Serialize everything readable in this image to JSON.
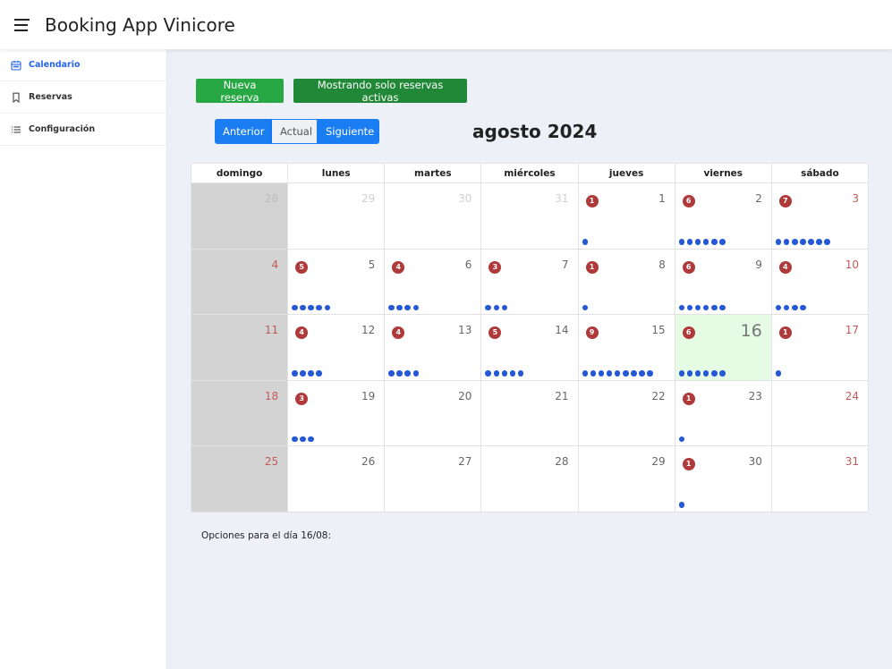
{
  "app": {
    "title": "Booking App Vinicore"
  },
  "sidebar": {
    "items": [
      {
        "label": "Calendario",
        "icon": "calendar-icon",
        "active": true
      },
      {
        "label": "Reservas",
        "icon": "bookmark-icon",
        "active": false
      },
      {
        "label": "Configuración",
        "icon": "list-icon",
        "active": false
      }
    ]
  },
  "toolbar": {
    "new_booking_label": "Nueva reserva",
    "active_filter_label": "Mostrando solo reservas activas"
  },
  "nav": {
    "prev_label": "Anterior",
    "today_label": "Actual",
    "next_label": "Siguiente"
  },
  "calendar": {
    "month_title": "agosto 2024",
    "weekdays": [
      "domingo",
      "lunes",
      "martes",
      "miércoles",
      "jueves",
      "viernes",
      "sábado"
    ],
    "weeks": [
      [
        {
          "d": "28",
          "other": true,
          "n": 0
        },
        {
          "d": "29",
          "other": true,
          "n": 0
        },
        {
          "d": "30",
          "other": true,
          "n": 0
        },
        {
          "d": "31",
          "other": true,
          "n": 0
        },
        {
          "d": "1",
          "n": 1
        },
        {
          "d": "2",
          "n": 6
        },
        {
          "d": "3",
          "n": 7
        }
      ],
      [
        {
          "d": "4",
          "n": 0
        },
        {
          "d": "5",
          "n": 5
        },
        {
          "d": "6",
          "n": 4
        },
        {
          "d": "7",
          "n": 3
        },
        {
          "d": "8",
          "n": 1
        },
        {
          "d": "9",
          "n": 6
        },
        {
          "d": "10",
          "n": 4
        }
      ],
      [
        {
          "d": "11",
          "n": 0
        },
        {
          "d": "12",
          "n": 4
        },
        {
          "d": "13",
          "n": 4
        },
        {
          "d": "14",
          "n": 5
        },
        {
          "d": "15",
          "n": 9
        },
        {
          "d": "16",
          "n": 6,
          "today": true
        },
        {
          "d": "17",
          "n": 1
        }
      ],
      [
        {
          "d": "18",
          "n": 0
        },
        {
          "d": "19",
          "n": 3
        },
        {
          "d": "20",
          "n": 0
        },
        {
          "d": "21",
          "n": 0
        },
        {
          "d": "22",
          "n": 0
        },
        {
          "d": "23",
          "n": 1
        },
        {
          "d": "24",
          "n": 0
        }
      ],
      [
        {
          "d": "25",
          "n": 0
        },
        {
          "d": "26",
          "n": 0
        },
        {
          "d": "27",
          "n": 0
        },
        {
          "d": "28",
          "n": 0
        },
        {
          "d": "29",
          "n": 0
        },
        {
          "d": "30",
          "n": 1
        },
        {
          "d": "31",
          "n": 0
        }
      ]
    ]
  },
  "options": {
    "label": "Opciones para el día 16/08:"
  },
  "colors": {
    "badge": "#b03a3a",
    "dot": "#2458d6",
    "today": "#e6fbe3",
    "sunday": "#d3d3d3",
    "accent": "#2563eb",
    "green": "#28a745",
    "blue": "#1a7ef2"
  }
}
